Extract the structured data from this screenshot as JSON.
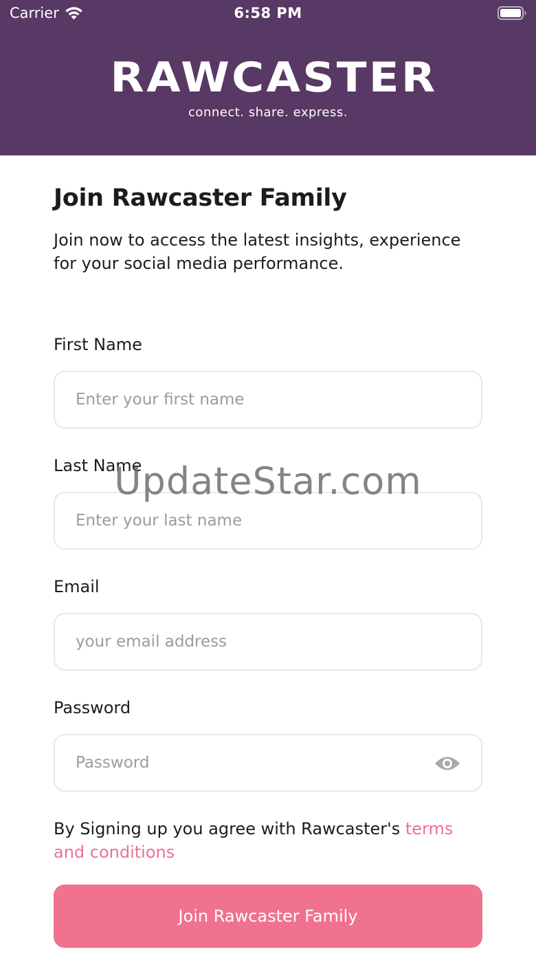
{
  "status_bar": {
    "carrier": "Carrier",
    "time": "6:58 PM"
  },
  "header": {
    "logo_text": "RAWCASTER",
    "tagline": "connect. share. express.",
    "background_color": "#583864"
  },
  "form": {
    "title": "Join Rawcaster Family",
    "subtitle": "Join now to access the latest insights, experience for your social media performance.",
    "fields": [
      {
        "label": "First Name",
        "placeholder": "Enter your first name",
        "value": ""
      },
      {
        "label": "Last Name",
        "placeholder": "Enter your last name",
        "value": ""
      },
      {
        "label": "Email",
        "placeholder": "your email address",
        "value": ""
      },
      {
        "label": "Password",
        "placeholder": "Password",
        "value": "",
        "icon": "eye-icon"
      }
    ],
    "terms_prefix": "By Signing up you agree with Rawcaster's",
    "terms_link": "terms and conditions",
    "submit_label": "Join Rawcaster Family",
    "accent_color": "#f0728e"
  },
  "watermark": "UpdateStar.com"
}
